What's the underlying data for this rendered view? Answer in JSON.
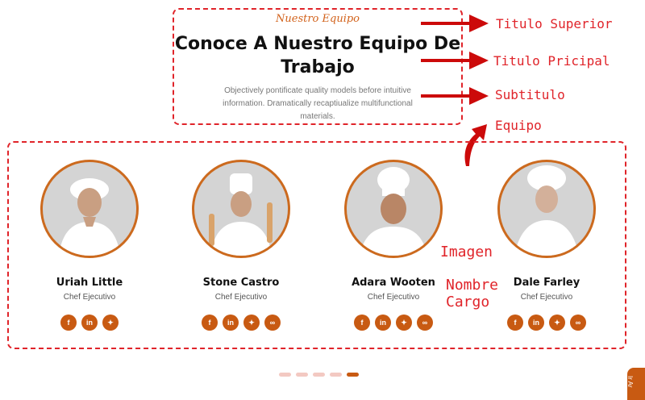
{
  "header": {
    "upper_title": "Nuestro Equipo",
    "main_title_line1": "Conoce A Nuestro Equipo De",
    "main_title_line2": "Trabajo",
    "subtitle": "Objectively pontificate quality models before intuitive information. Dramatically recaptiualize multifunctional materials."
  },
  "annotations": {
    "titulo_superior": "Titulo Superior",
    "titulo_principal": "Titulo Pricipal",
    "subtitulo": "Subtitulo",
    "equipo": "Equipo",
    "imagen": "Imagen",
    "nombre": "Nombre",
    "cargo": "Cargo"
  },
  "team": [
    {
      "name": "Uriah Little",
      "role": "Chef Ejecutivo",
      "socials": [
        "f",
        "in",
        "tw"
      ]
    },
    {
      "name": "Stone Castro",
      "role": "Chef Ejecutivo",
      "socials": [
        "f",
        "in",
        "tw",
        "link"
      ]
    },
    {
      "name": "Adara Wooten",
      "role": "Chef Ejecutivo",
      "socials": [
        "f",
        "in",
        "tw",
        "link"
      ]
    },
    {
      "name": "Dale Farley",
      "role": "Chef Ejecutivo",
      "socials": [
        "f",
        "in",
        "tw",
        "link"
      ]
    }
  ],
  "carousel": {
    "pages": 5,
    "active_page": 5
  },
  "side_tab": {
    "label": "Ir Ar"
  },
  "colors": {
    "accent": "#c85a12",
    "annotation": "#e0242a",
    "dot_inactive": "#f3c9c2"
  }
}
